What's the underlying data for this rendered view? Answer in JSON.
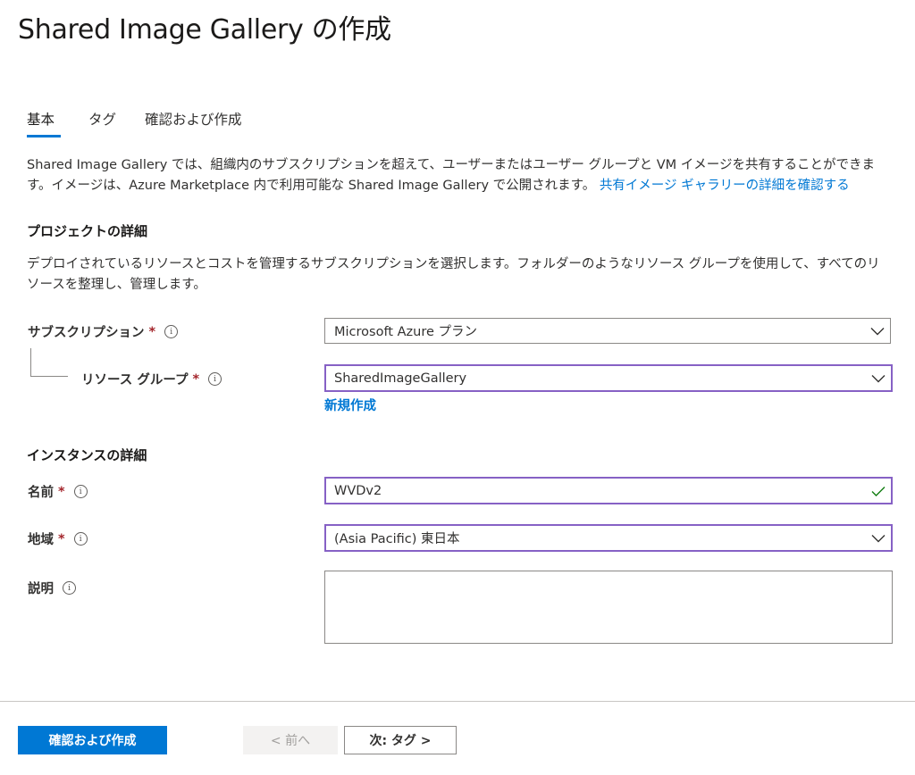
{
  "page": {
    "title": "Shared Image Gallery の作成"
  },
  "tabs": [
    {
      "label": "基本",
      "active": true
    },
    {
      "label": "タグ",
      "active": false
    },
    {
      "label": "確認および作成",
      "active": false
    }
  ],
  "intro": {
    "text": "Shared Image Gallery では、組織内のサブスクリプションを超えて、ユーザーまたはユーザー グループと VM イメージを共有することができます。イメージは、Azure Marketplace 内で利用可能な Shared Image Gallery で公開されます。 ",
    "link": "共有イメージ ギャラリーの詳細を確認する"
  },
  "project": {
    "heading": "プロジェクトの詳細",
    "description": "デプロイされているリソースとコストを管理するサブスクリプションを選択します。フォルダーのようなリソース グループを使用して、すべてのリソースを整理し、管理します。",
    "subscription": {
      "label": "サブスクリプション",
      "required": "*",
      "value": "Microsoft Azure プラン"
    },
    "resource_group": {
      "label": "リソース グループ",
      "required": "*",
      "value": "SharedImageGallery",
      "new_link": "新規作成"
    }
  },
  "instance": {
    "heading": "インスタンスの詳細",
    "name": {
      "label": "名前",
      "required": "*",
      "value": "WVDv2"
    },
    "region": {
      "label": "地域",
      "required": "*",
      "value": "(Asia Pacific) 東日本"
    },
    "description": {
      "label": "説明",
      "value": ""
    }
  },
  "icons": {
    "info": "i"
  },
  "footer": {
    "review_create": "確認および作成",
    "previous": "< 前へ",
    "next": "次: タグ >"
  },
  "colors": {
    "accent": "#0078d4",
    "focus_border": "#8661c5",
    "required": "#a4262c",
    "valid_check": "#107c10"
  }
}
